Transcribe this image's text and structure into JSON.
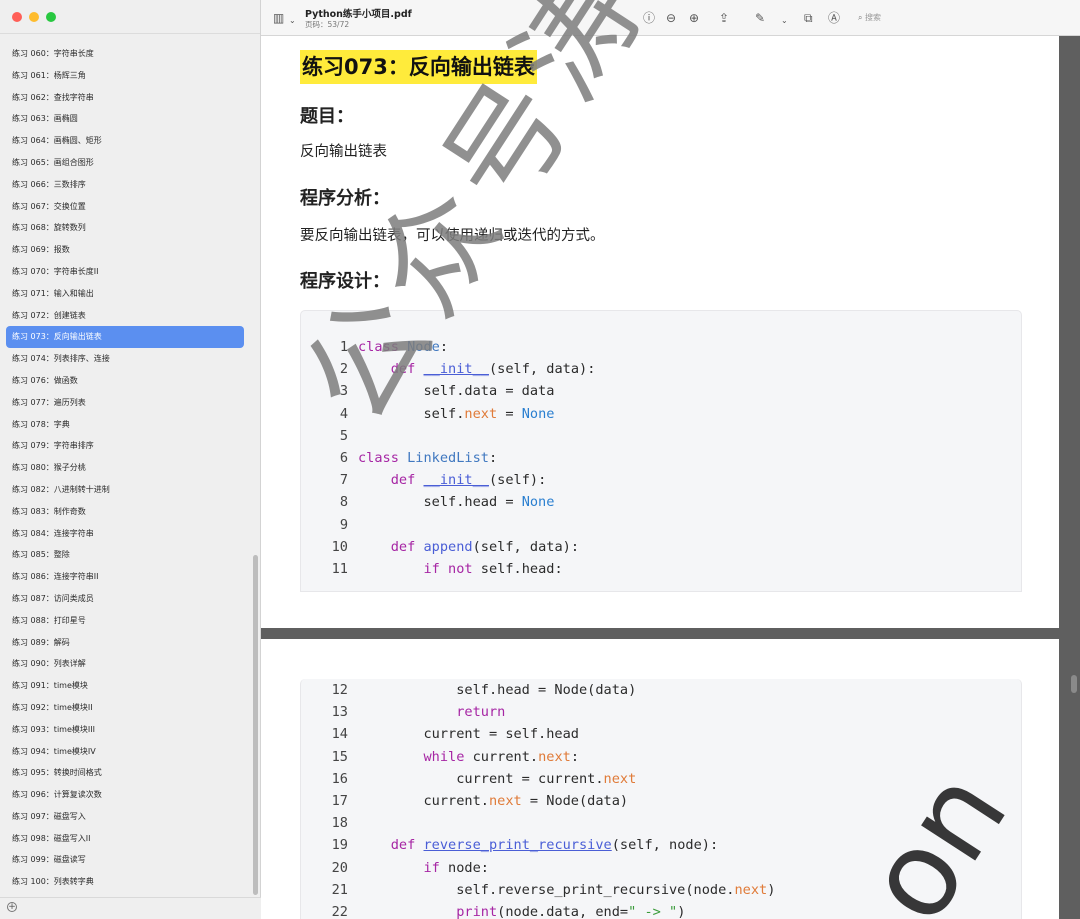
{
  "window": {
    "doc_title": "Python练手小项目.pdf",
    "page_info": "页码：53/72",
    "search_placeholder": "搜索"
  },
  "sidebar": {
    "items": [
      "练习 060：字符串长度",
      "练习 061：杨辉三角",
      "练习 062：查找字符串",
      "练习 063：画椭圆",
      "练习 064：画椭圆、矩形",
      "练习 065：画组合图形",
      "练习 066：三数排序",
      "练习 067：交换位置",
      "练习 068：旋转数列",
      "练习 069：报数",
      "练习 070：字符串长度II",
      "练习 071：输入和输出",
      "练习 072：创建链表",
      "练习 073：反向输出链表",
      "练习 074：列表排序、连接",
      "练习 076：做函数",
      "练习 077：遍历列表",
      "练习 078：字典",
      "练习 079：字符串排序",
      "练习 080：猴子分桃",
      "练习 082：八进制转十进制",
      "练习 083：制作奇数",
      "练习 084：连接字符串",
      "练习 085：整除",
      "练习 086：连接字符串II",
      "练习 087：访问类成员",
      "练习 088：打印星号",
      "练习 089：解码",
      "练习 090：列表详解",
      "练习 091：time模块",
      "练习 092：time模块II",
      "练习 093：time模块III",
      "练习 094：time模块IV",
      "练习 095：转换时间格式",
      "练习 096：计算复读次数",
      "练习 097：磁盘写入",
      "练习 098：磁盘写入II",
      "练习 099：磁盘读写",
      "练习 100：列表转字典"
    ],
    "active_index": 13
  },
  "content": {
    "title": "练习073：反向输出链表",
    "h_topic": "题目：",
    "topic_text": "反向输出链表",
    "h_analysis": "程序分析：",
    "analysis_text": "要反向输出链表，可以使用递归或迭代的方式。",
    "h_design": "程序设计："
  },
  "code_page1": [
    {
      "n": "1",
      "html": "<span class='kw'>class</span> <span class='cls'>Node</span>:"
    },
    {
      "n": "2",
      "html": "    <span class='kw'>def</span> <span class='fn'>__init__</span>(self, data):"
    },
    {
      "n": "3",
      "html": "        self.data = data"
    },
    {
      "n": "4",
      "html": "        self.<span class='attr'>next</span> = <span class='cst'>None</span>"
    },
    {
      "n": "5",
      "html": ""
    },
    {
      "n": "6",
      "html": "<span class='kw'>class</span> <span class='cls'>LinkedList</span>:"
    },
    {
      "n": "7",
      "html": "    <span class='kw'>def</span> <span class='fn'>__init__</span>(self):"
    },
    {
      "n": "8",
      "html": "        self.head = <span class='cst'>None</span>"
    },
    {
      "n": "9",
      "html": ""
    },
    {
      "n": "10",
      "html": "    <span class='kw'>def</span> <span class='fn' style='text-decoration:none'>append</span>(self, data):"
    },
    {
      "n": "11",
      "html": "        <span class='kw'>if</span> <span class='kw'>not</span> self.head:"
    }
  ],
  "code_page2": [
    {
      "n": "12",
      "html": "            self.head = Node(data)"
    },
    {
      "n": "13",
      "html": "            <span class='kw'>return</span>"
    },
    {
      "n": "14",
      "html": "        current = self.head"
    },
    {
      "n": "15",
      "html": "        <span class='kw'>while</span> current.<span class='attr'>next</span>:"
    },
    {
      "n": "16",
      "html": "            current = current.<span class='attr'>next</span>"
    },
    {
      "n": "17",
      "html": "        current.<span class='attr'>next</span> = Node(data)"
    },
    {
      "n": "18",
      "html": ""
    },
    {
      "n": "19",
      "html": "    <span class='kw'>def</span> <span class='fn'>reverse_print_recursive</span>(self, node):"
    },
    {
      "n": "20",
      "html": "        <span class='kw'>if</span> node:"
    },
    {
      "n": "21",
      "html": "            self.reverse_print_recursive(node.<span class='attr'>next</span>)"
    },
    {
      "n": "22",
      "html": "            <span class='kw'>print</span>(node.data, end=<span class='str'>\" -> \"</span>)"
    }
  ],
  "watermark": "公众号涛哥"
}
